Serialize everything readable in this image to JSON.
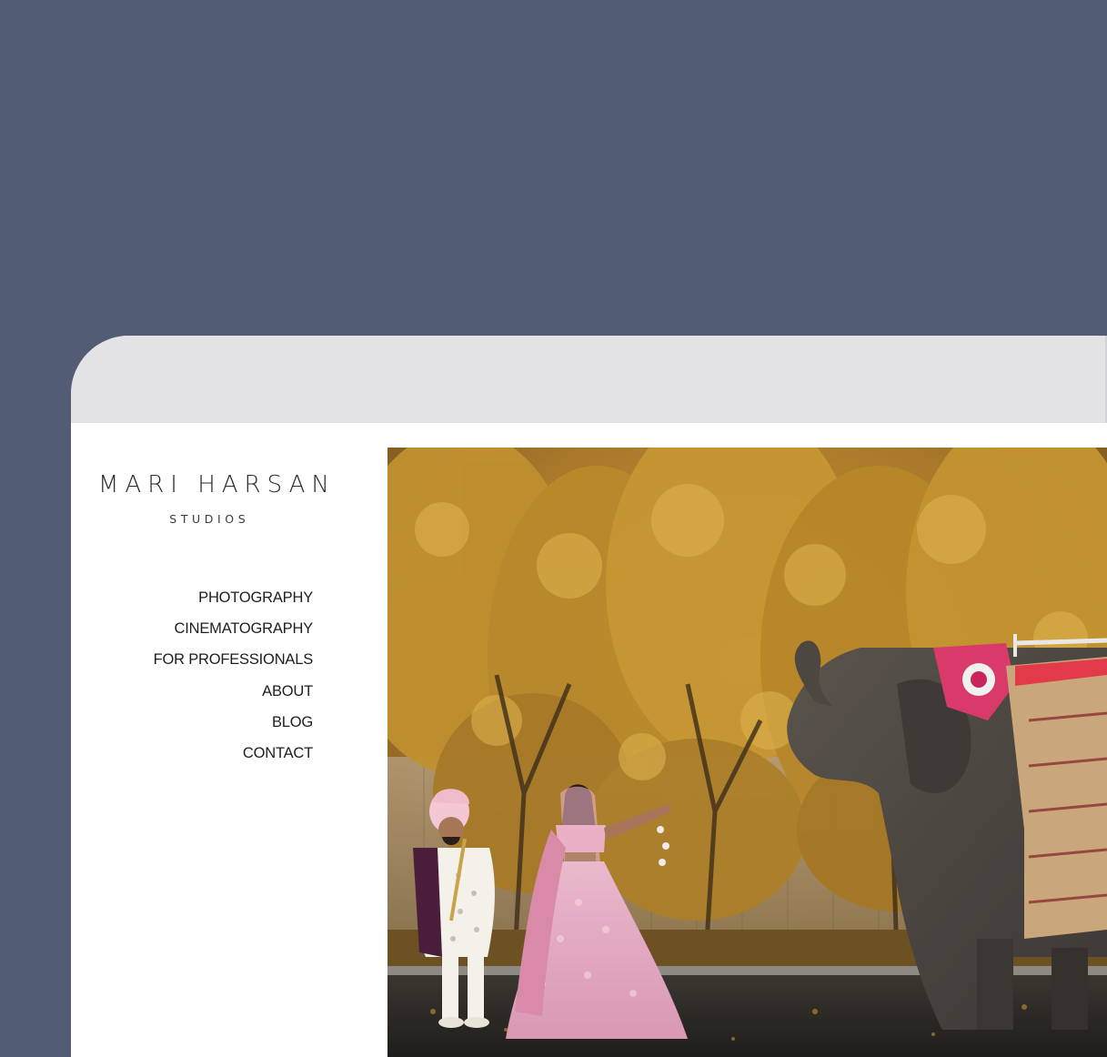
{
  "logo": {
    "name": "MARI HARSAN",
    "sub": "STUDIOS"
  },
  "nav": {
    "items": [
      {
        "label": "PHOTOGRAPHY"
      },
      {
        "label": "CINEMATOGRAPHY"
      },
      {
        "label": "FOR PROFESSIONALS"
      },
      {
        "label": "ABOUT"
      },
      {
        "label": "BLOG"
      },
      {
        "label": "CONTACT"
      }
    ]
  },
  "colors": {
    "backdrop": "#525c74",
    "bezel": "#e3e3e5",
    "page": "#ffffff",
    "text": "#1e1e1e"
  },
  "hero": {
    "icon": "wedding-photo-image"
  }
}
